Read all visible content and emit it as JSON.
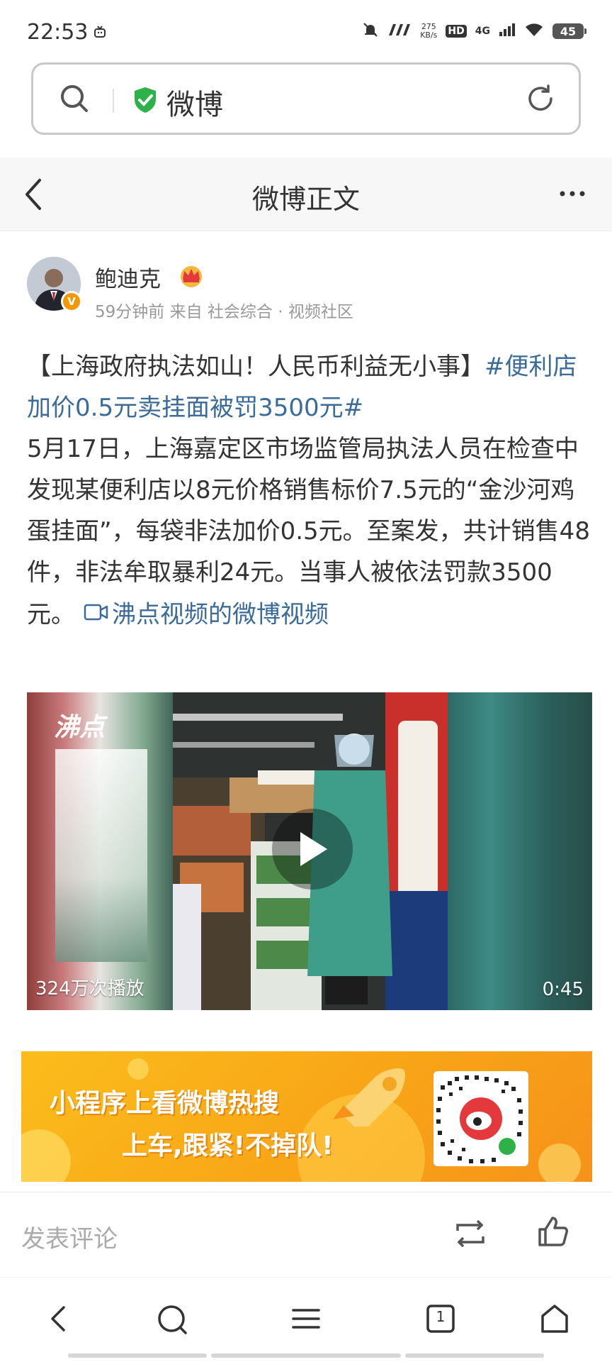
{
  "status_bar": {
    "time": "22:53",
    "speed_top": "275",
    "speed_bottom": "KB/s",
    "hd": "HD",
    "network": "4G",
    "battery": "45"
  },
  "address_bar": {
    "title": "微博",
    "icons": [
      "search-icon",
      "shield-check-icon",
      "reload-icon"
    ],
    "accent_color": "#2db24a"
  },
  "nav": {
    "title": "微博正文",
    "icons": [
      "back-icon",
      "more-icon"
    ]
  },
  "post": {
    "author": "鲍迪克",
    "verified_badge": "V",
    "time": "59分钟前",
    "source_prefix": "来自",
    "source": "社会综合 · 视频社区",
    "headline": "【上海政府执法如山！人民币利益无小事】",
    "hashtag": "#便利店加价0.5元卖挂面被罚3500元#",
    "body": "5月17日，上海嘉定区市场监管局执法人员在检查中发现某便利店以8元价格销售标价7.5元的“金沙河鸡蛋挂面”，每袋非法加价0.5元。至案发，共计销售48件，非法牟取暴利24元。当事人被依法罚款3500元。",
    "video_link": "沸点视频的微博视频",
    "link_color": "#3a6b9a"
  },
  "video": {
    "logo": "沸点",
    "plays": "324万次播放",
    "duration": "0:45"
  },
  "banner": {
    "line1": "小程序上看微博热搜",
    "line2": "上车,跟紧!不掉队!"
  },
  "comment_bar": {
    "placeholder": "发表评论",
    "icons": [
      "repost-icon",
      "like-icon"
    ]
  },
  "bottom_nav": {
    "tab_count": "1",
    "icons": [
      "back-icon",
      "search-icon",
      "menu-icon",
      "tabs-icon",
      "home-icon"
    ]
  }
}
